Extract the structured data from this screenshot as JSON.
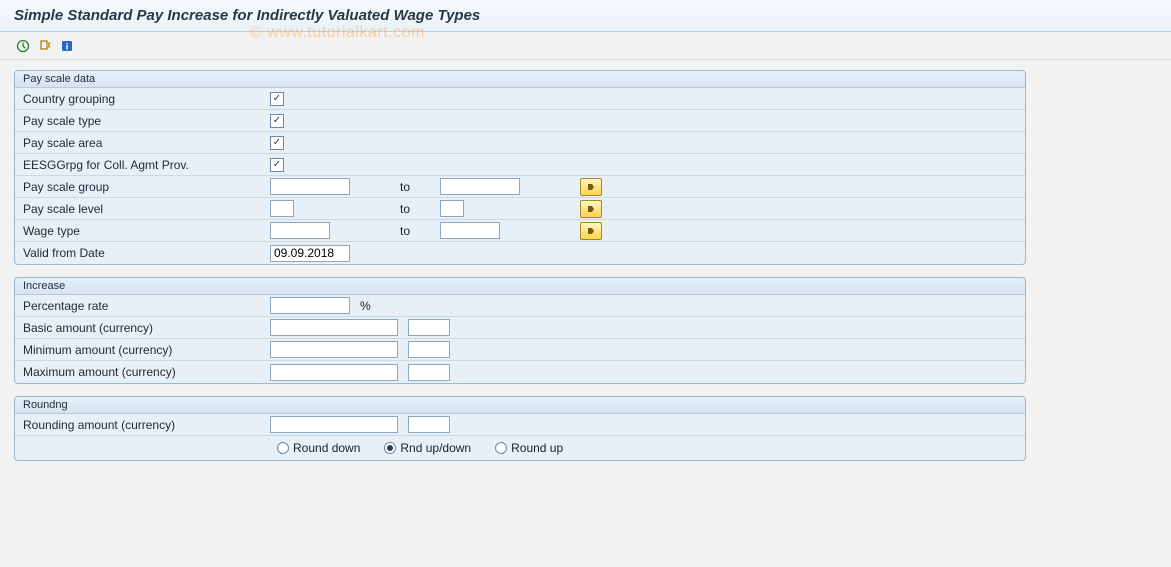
{
  "title": "Simple Standard Pay Increase for Indirectly Valuated Wage Types",
  "watermark": "© www.tutorialkart.com",
  "toolbar": {
    "execute": "execute-icon",
    "variant": "variant-icon",
    "info": "info-icon"
  },
  "sections": {
    "pay_scale_data": {
      "legend": "Pay scale data",
      "fields": {
        "country_grouping": {
          "label": "Country grouping",
          "checked": true
        },
        "pay_scale_type": {
          "label": "Pay scale type",
          "checked": true
        },
        "pay_scale_area": {
          "label": "Pay scale area",
          "checked": true
        },
        "eesg_grouping": {
          "label": "EESGGrpg for Coll. Agmt Prov.",
          "checked": true
        },
        "pay_scale_group": {
          "label": "Pay scale group",
          "from": "",
          "to_label": "to",
          "to": ""
        },
        "pay_scale_level": {
          "label": "Pay scale level",
          "from": "",
          "to_label": "to",
          "to": ""
        },
        "wage_type": {
          "label": "Wage type",
          "from": "",
          "to_label": "to",
          "to": ""
        },
        "valid_from": {
          "label": "Valid from Date",
          "value": "09.09.2018"
        }
      }
    },
    "increase": {
      "legend": "Increase",
      "fields": {
        "percentage_rate": {
          "label": "Percentage rate",
          "value": "",
          "unit": "%"
        },
        "basic_amount": {
          "label": "Basic amount (currency)",
          "value": "",
          "currency": ""
        },
        "minimum_amount": {
          "label": "Minimum amount (currency)",
          "value": "",
          "currency": ""
        },
        "maximum_amount": {
          "label": "Maximum amount (currency)",
          "value": "",
          "currency": ""
        }
      }
    },
    "rounding": {
      "legend": "Roundng",
      "amount": {
        "label": "Rounding amount (currency)",
        "value": "",
        "currency": ""
      },
      "options": {
        "round_down": "Round down",
        "rnd_up_down": "Rnd up/down",
        "round_up": "Round up",
        "selected": "rnd_up_down"
      }
    }
  }
}
